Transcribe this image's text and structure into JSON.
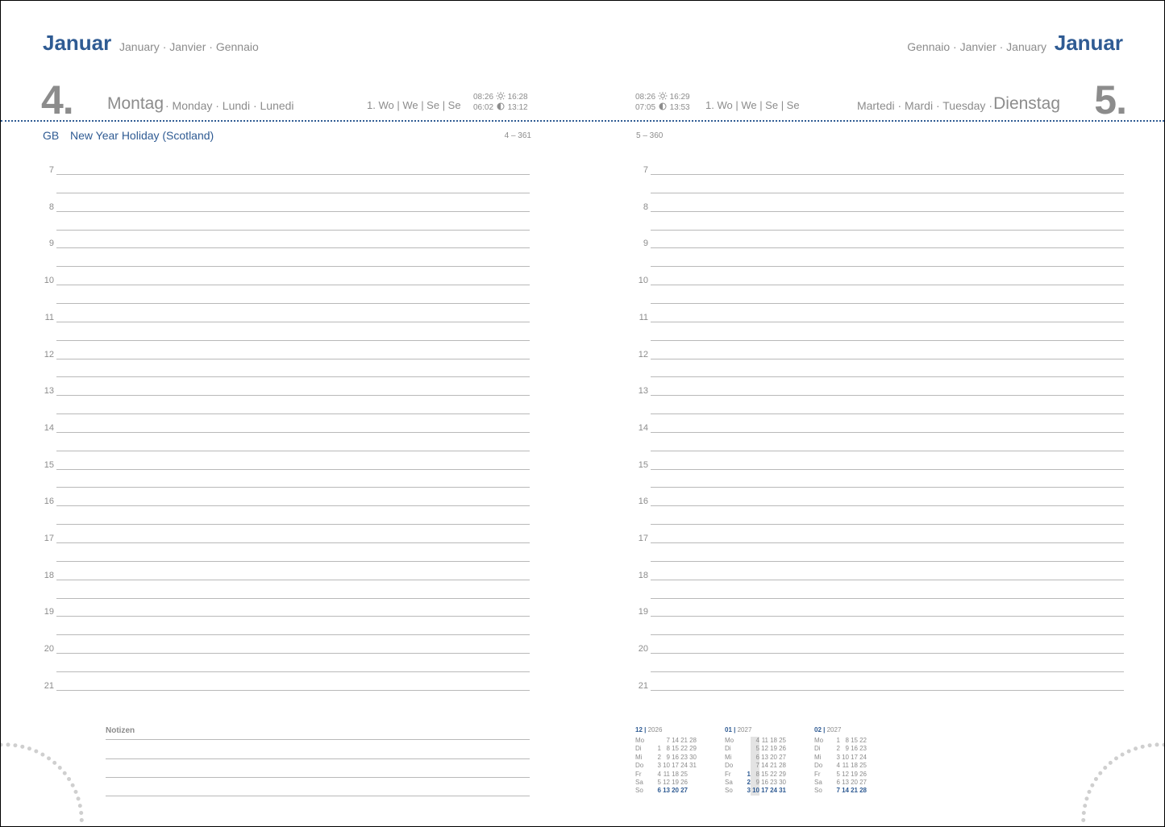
{
  "left_page": {
    "month": "Januar",
    "month_translations": "January · Janvier · Gennaio",
    "day_number": "4.",
    "weekday": "Montag",
    "weekday_translations": "· Monday · Lundi · Lunedi",
    "week_info": "1. Wo | We | Se | Se",
    "sunrise": "08:26",
    "sunset": "16:28",
    "moonrise": "06:02",
    "moonset": "13:12",
    "holiday_country": "GB",
    "holiday_name": "New Year Holiday (Scotland)",
    "day_of_year": "4 – 361",
    "notes_label": "Notizen"
  },
  "right_page": {
    "month": "Januar",
    "month_translations": "Gennaio · Janvier · January",
    "day_number": "5.",
    "weekday": "Dienstag",
    "weekday_translations": "Martedi · Mardi · Tuesday ·",
    "week_info": "1. Wo | We | Se | Se",
    "sunrise": "08:26",
    "sunset": "16:29",
    "moonrise": "07:05",
    "moonset": "13:53",
    "day_of_year": "5 – 360"
  },
  "hours": [
    "7",
    "8",
    "9",
    "10",
    "11",
    "12",
    "13",
    "14",
    "15",
    "16",
    "17",
    "18",
    "19",
    "20",
    "21"
  ],
  "mini_calendars": [
    {
      "month": "12",
      "year": "2026",
      "rows": [
        {
          "label": "Mo",
          "days": [
            "",
            "7",
            "14",
            "21",
            "28"
          ]
        },
        {
          "label": "Di",
          "days": [
            "1",
            "8",
            "15",
            "22",
            "29"
          ]
        },
        {
          "label": "Mi",
          "days": [
            "2",
            "9",
            "16",
            "23",
            "30"
          ]
        },
        {
          "label": "Do",
          "days": [
            "3",
            "10",
            "17",
            "24",
            "31"
          ]
        },
        {
          "label": "Fr",
          "days": [
            "4",
            "11",
            "18",
            "25",
            ""
          ]
        },
        {
          "label": "Sa",
          "days": [
            "5",
            "12",
            "19",
            "26",
            ""
          ]
        },
        {
          "label": "So",
          "days": [
            "6",
            "13",
            "20",
            "27",
            ""
          ]
        }
      ]
    },
    {
      "month": "01",
      "year": "2027",
      "rows": [
        {
          "label": "Mo",
          "days": [
            "",
            "4",
            "11",
            "18",
            "25"
          ]
        },
        {
          "label": "Di",
          "days": [
            "",
            "5",
            "12",
            "19",
            "26"
          ]
        },
        {
          "label": "Mi",
          "days": [
            "",
            "6",
            "13",
            "20",
            "27"
          ]
        },
        {
          "label": "Do",
          "days": [
            "",
            "7",
            "14",
            "21",
            "28"
          ]
        },
        {
          "label": "Fr",
          "days": [
            "1",
            "8",
            "15",
            "22",
            "29"
          ]
        },
        {
          "label": "Sa",
          "days": [
            "2",
            "9",
            "16",
            "23",
            "30"
          ]
        },
        {
          "label": "So",
          "days": [
            "3",
            "10",
            "17",
            "24",
            "31"
          ]
        }
      ]
    },
    {
      "month": "02",
      "year": "2027",
      "rows": [
        {
          "label": "Mo",
          "days": [
            "1",
            "8",
            "15",
            "22"
          ]
        },
        {
          "label": "Di",
          "days": [
            "2",
            "9",
            "16",
            "23"
          ]
        },
        {
          "label": "Mi",
          "days": [
            "3",
            "10",
            "17",
            "24"
          ]
        },
        {
          "label": "Do",
          "days": [
            "4",
            "11",
            "18",
            "25"
          ]
        },
        {
          "label": "Fr",
          "days": [
            "5",
            "12",
            "19",
            "26"
          ]
        },
        {
          "label": "Sa",
          "days": [
            "6",
            "13",
            "20",
            "27"
          ]
        },
        {
          "label": "So",
          "days": [
            "7",
            "14",
            "21",
            "28"
          ]
        }
      ]
    }
  ],
  "colors": {
    "accent": "#2f5b93",
    "text": "#8c8c8c",
    "rule": "#b9b9b9",
    "highlight": "#e3e3e3"
  }
}
